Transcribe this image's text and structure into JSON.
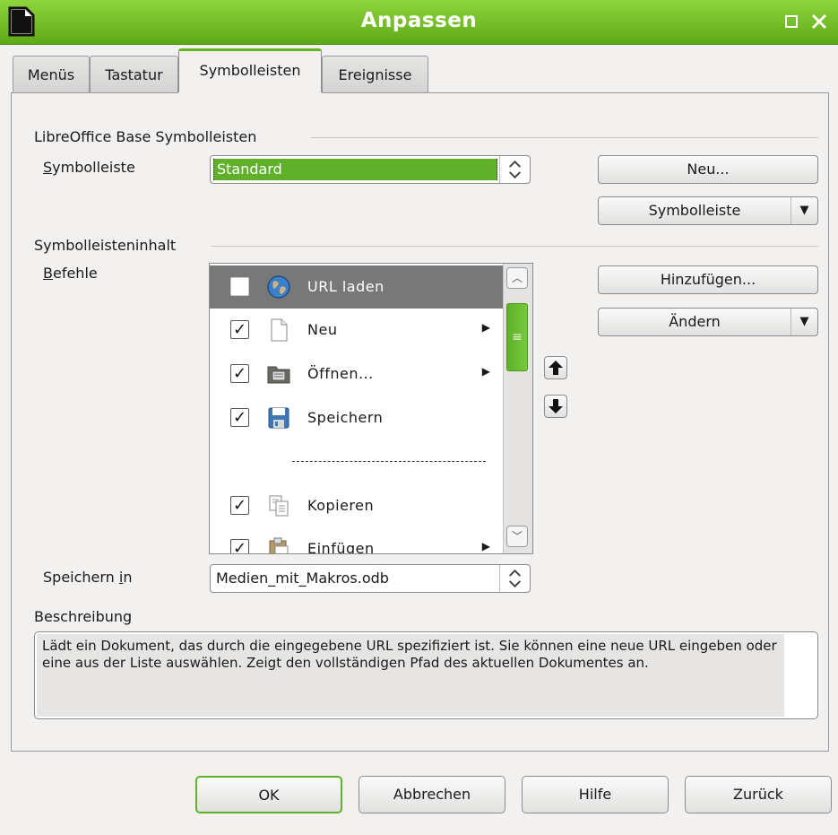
{
  "window": {
    "title": "Anpassen",
    "accent": "#5fb12a"
  },
  "tabs": [
    {
      "label": "Menüs"
    },
    {
      "label": "Tastatur"
    },
    {
      "label": "Symbolleisten",
      "active": true
    },
    {
      "label": "Ereignisse"
    }
  ],
  "toolbars_section": {
    "heading": "LibreOffice Base Symbolleisten",
    "toolbar_label": "Symbolleiste",
    "toolbar_value": "Standard",
    "new_button": "Neu...",
    "toolbar_menu_button": "Symbolleiste"
  },
  "content_section": {
    "heading": "Symbolleisteninhalt",
    "commands_label": "Befehle",
    "add_button": "Hinzufügen...",
    "modify_button": "Ändern",
    "commands": [
      {
        "label": "URL laden",
        "checked": false,
        "icon": "globe-icon",
        "selected": true
      },
      {
        "label": "Neu",
        "checked": true,
        "icon": "document-icon",
        "submenu": true
      },
      {
        "label": "Öffnen...",
        "checked": true,
        "icon": "folder-icon",
        "submenu": true
      },
      {
        "label": "Speichern",
        "checked": true,
        "icon": "floppy-icon"
      },
      {
        "separator": true,
        "label": "----------------------------------"
      },
      {
        "label": "Kopieren",
        "checked": true,
        "icon": "copy-icon"
      },
      {
        "label": "Einfügen",
        "checked": true,
        "icon": "paste-icon",
        "submenu": true
      }
    ],
    "save_in_label": "Speichern in",
    "save_in_value": "Medien_mit_Makros.odb"
  },
  "description": {
    "label": "Beschreibung",
    "text": "Lädt ein Dokument, das durch die eingegebene URL spezifiziert ist. Sie können eine neue URL eingeben oder eine aus der Liste auswählen. Zeigt den vollständigen Pfad des aktuellen Dokumentes an."
  },
  "footer": {
    "ok": "OK",
    "cancel": "Abbrechen",
    "help": "Hilfe",
    "reset": "Zurück"
  }
}
